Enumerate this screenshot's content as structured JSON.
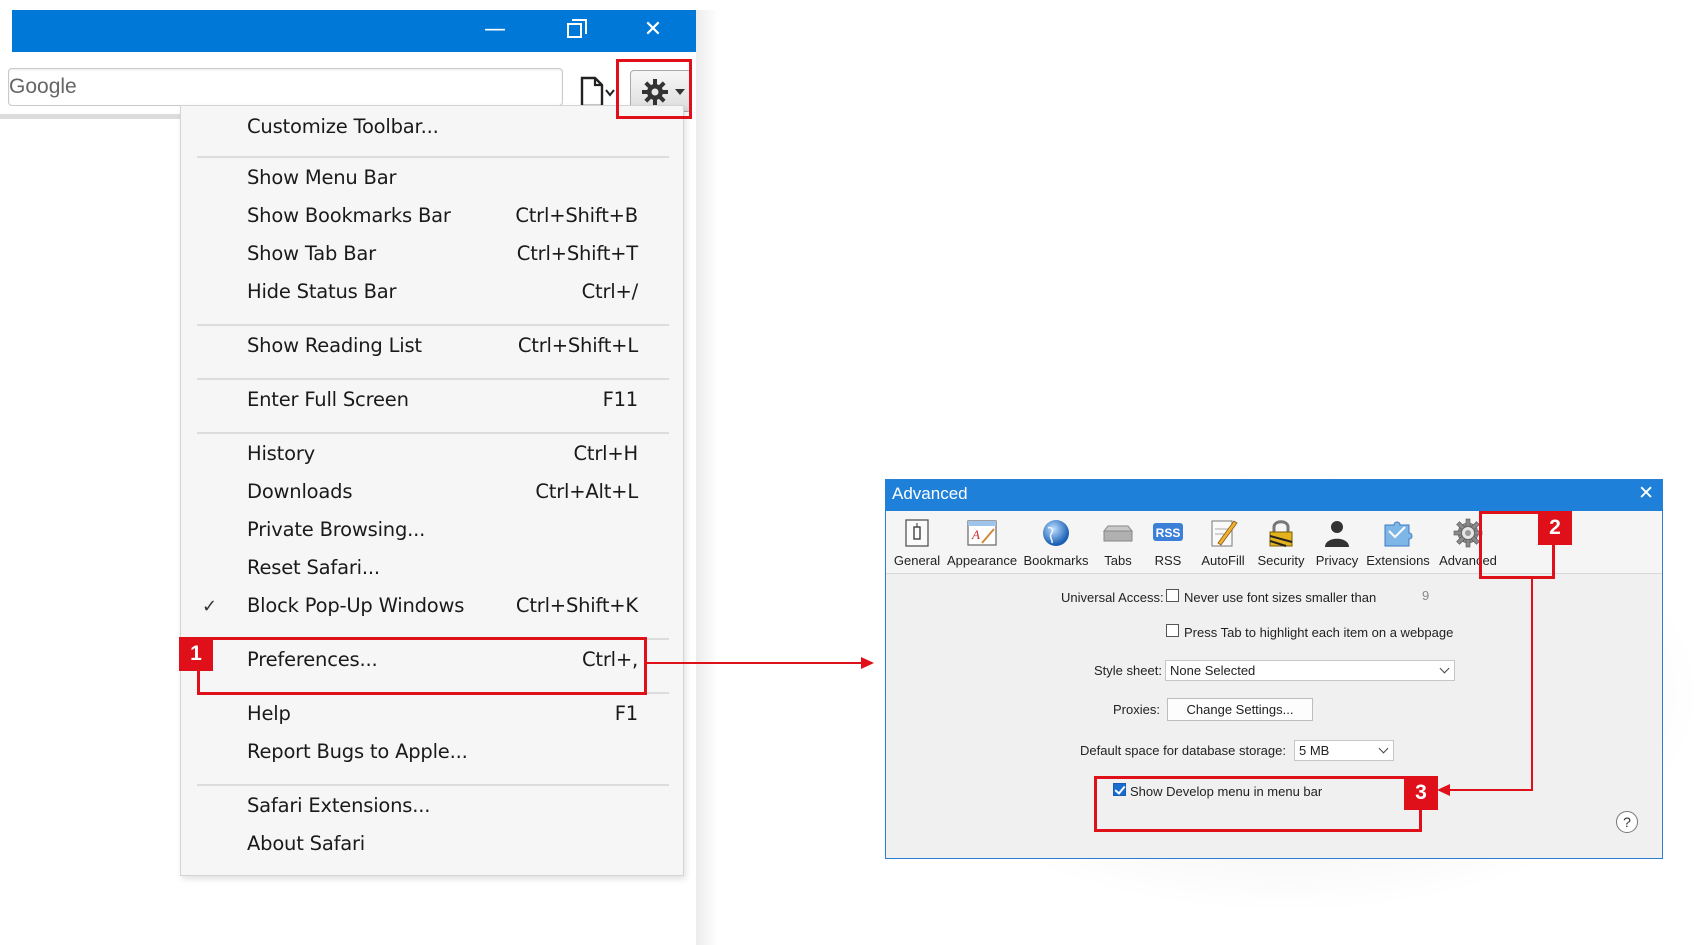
{
  "colors": {
    "title_blue": "#0078d7",
    "dialog_blue": "#1e80d9",
    "annotation_red": "#e0101a"
  },
  "safari": {
    "window_controls": {
      "minimize": "—",
      "close": "✕"
    },
    "search_value": "Google",
    "menu": {
      "items": [
        {
          "label": "Customize Toolbar...",
          "shortcut": ""
        },
        {
          "label": "Show Menu Bar",
          "shortcut": ""
        },
        {
          "label": "Show Bookmarks Bar",
          "shortcut": "Ctrl+Shift+B"
        },
        {
          "label": "Show Tab Bar",
          "shortcut": "Ctrl+Shift+T"
        },
        {
          "label": "Hide Status Bar",
          "shortcut": "Ctrl+/"
        },
        {
          "label": "Show Reading List",
          "shortcut": "Ctrl+Shift+L"
        },
        {
          "label": "Enter Full Screen",
          "shortcut": "F11"
        },
        {
          "label": "History",
          "shortcut": "Ctrl+H"
        },
        {
          "label": "Downloads",
          "shortcut": "Ctrl+Alt+L"
        },
        {
          "label": "Private Browsing...",
          "shortcut": ""
        },
        {
          "label": "Reset Safari...",
          "shortcut": ""
        },
        {
          "label": "Block Pop-Up Windows",
          "shortcut": "Ctrl+Shift+K",
          "check": "✓"
        },
        {
          "label": "Preferences...",
          "shortcut": "Ctrl+,"
        },
        {
          "label": "Help",
          "shortcut": "F1"
        },
        {
          "label": "Report Bugs to Apple...",
          "shortcut": ""
        },
        {
          "label": "Safari Extensions...",
          "shortcut": ""
        },
        {
          "label": "About Safari",
          "shortcut": ""
        }
      ]
    }
  },
  "annotations": {
    "badge_1": "1",
    "badge_2": "2",
    "badge_3": "3"
  },
  "dialog": {
    "title": "Advanced",
    "close": "✕",
    "toolbar": [
      {
        "label": "General",
        "icon": "general-icon"
      },
      {
        "label": "Appearance",
        "icon": "appearance-icon"
      },
      {
        "label": "Bookmarks",
        "icon": "bookmarks-globe-icon"
      },
      {
        "label": "Tabs",
        "icon": "tabs-icon"
      },
      {
        "label": "RSS",
        "icon": "rss-icon"
      },
      {
        "label": "AutoFill",
        "icon": "autofill-pencil-icon"
      },
      {
        "label": "Security",
        "icon": "security-lock-icon"
      },
      {
        "label": "Privacy",
        "icon": "privacy-person-icon"
      },
      {
        "label": "Extensions",
        "icon": "extensions-puzzle-icon"
      },
      {
        "label": "Advanced",
        "icon": "advanced-gear-icon"
      }
    ],
    "rss_icon_text": "RSS",
    "universal_access_label": "Universal Access:",
    "never_font_label": "Never use font sizes smaller than",
    "min_font_size": "9",
    "press_tab_label": "Press Tab to highlight each item on a webpage",
    "style_sheet_label": "Style sheet:",
    "style_sheet_value": "None Selected",
    "proxies_label": "Proxies:",
    "proxies_button": "Change Settings...",
    "db_storage_label": "Default space for database storage:",
    "db_storage_value": "5 MB",
    "show_develop_label": "Show Develop menu in menu bar",
    "help_button": "?"
  }
}
